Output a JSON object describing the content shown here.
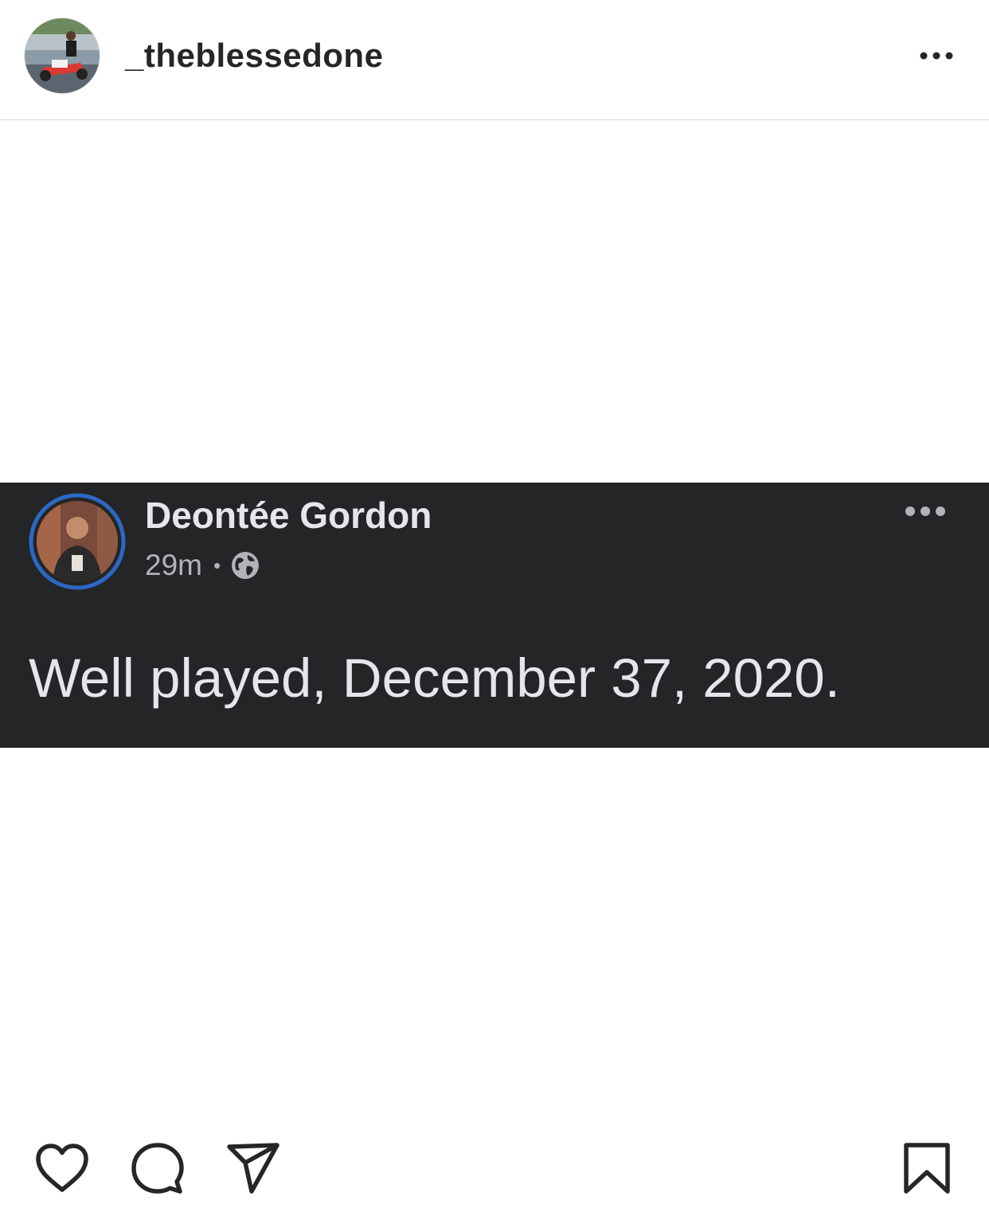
{
  "header": {
    "username": "_theblessedone",
    "avatar_icon": "profile-photo-person-on-scooter",
    "more_icon": "more-horizontal-icon"
  },
  "post": {
    "fb_card": {
      "author": "Deontée Gordon",
      "time": "29m",
      "separator": "•",
      "privacy_icon": "globe-icon",
      "more_icon": "more-horizontal-icon",
      "text": "Well played, December 37, 2020.",
      "background_color": "#242526",
      "avatar_ring_color": "#2d68c4"
    }
  },
  "actions": {
    "like_icon": "heart-icon",
    "comment_icon": "comment-icon",
    "share_icon": "paper-plane-icon",
    "save_icon": "bookmark-icon"
  }
}
